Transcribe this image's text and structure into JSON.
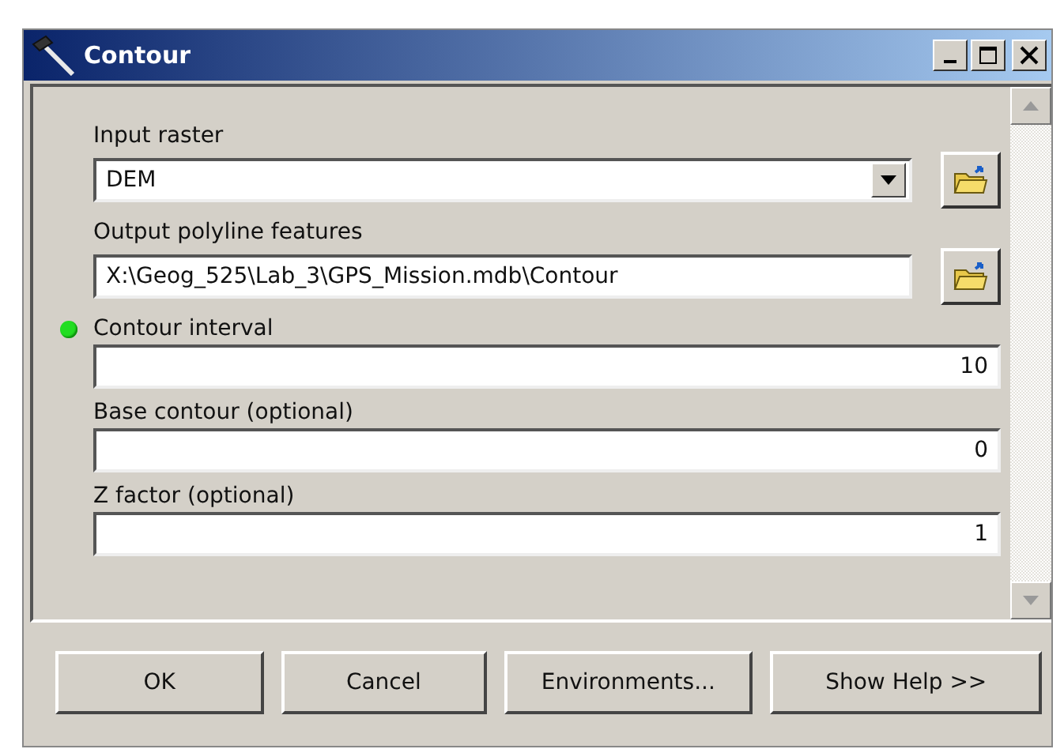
{
  "window": {
    "title": "Contour"
  },
  "parameters": [
    {
      "label": "Input raster",
      "kind": "dropdown",
      "value": "DEM",
      "browse": true,
      "indicator": false
    },
    {
      "label": "Output polyline features",
      "kind": "text",
      "value": "X:\\Geog_525\\Lab_3\\GPS_Mission.mdb\\Contour",
      "browse": true,
      "indicator": false
    },
    {
      "label": "Contour interval",
      "kind": "number",
      "value": "10",
      "browse": false,
      "indicator": true
    },
    {
      "label": "Base contour (optional)",
      "kind": "number",
      "value": "0",
      "browse": false,
      "indicator": false
    },
    {
      "label": "Z factor (optional)",
      "kind": "number",
      "value": "1",
      "browse": false,
      "indicator": false
    }
  ],
  "buttons": [
    "OK",
    "Cancel",
    "Environments...",
    "Show Help >>"
  ]
}
